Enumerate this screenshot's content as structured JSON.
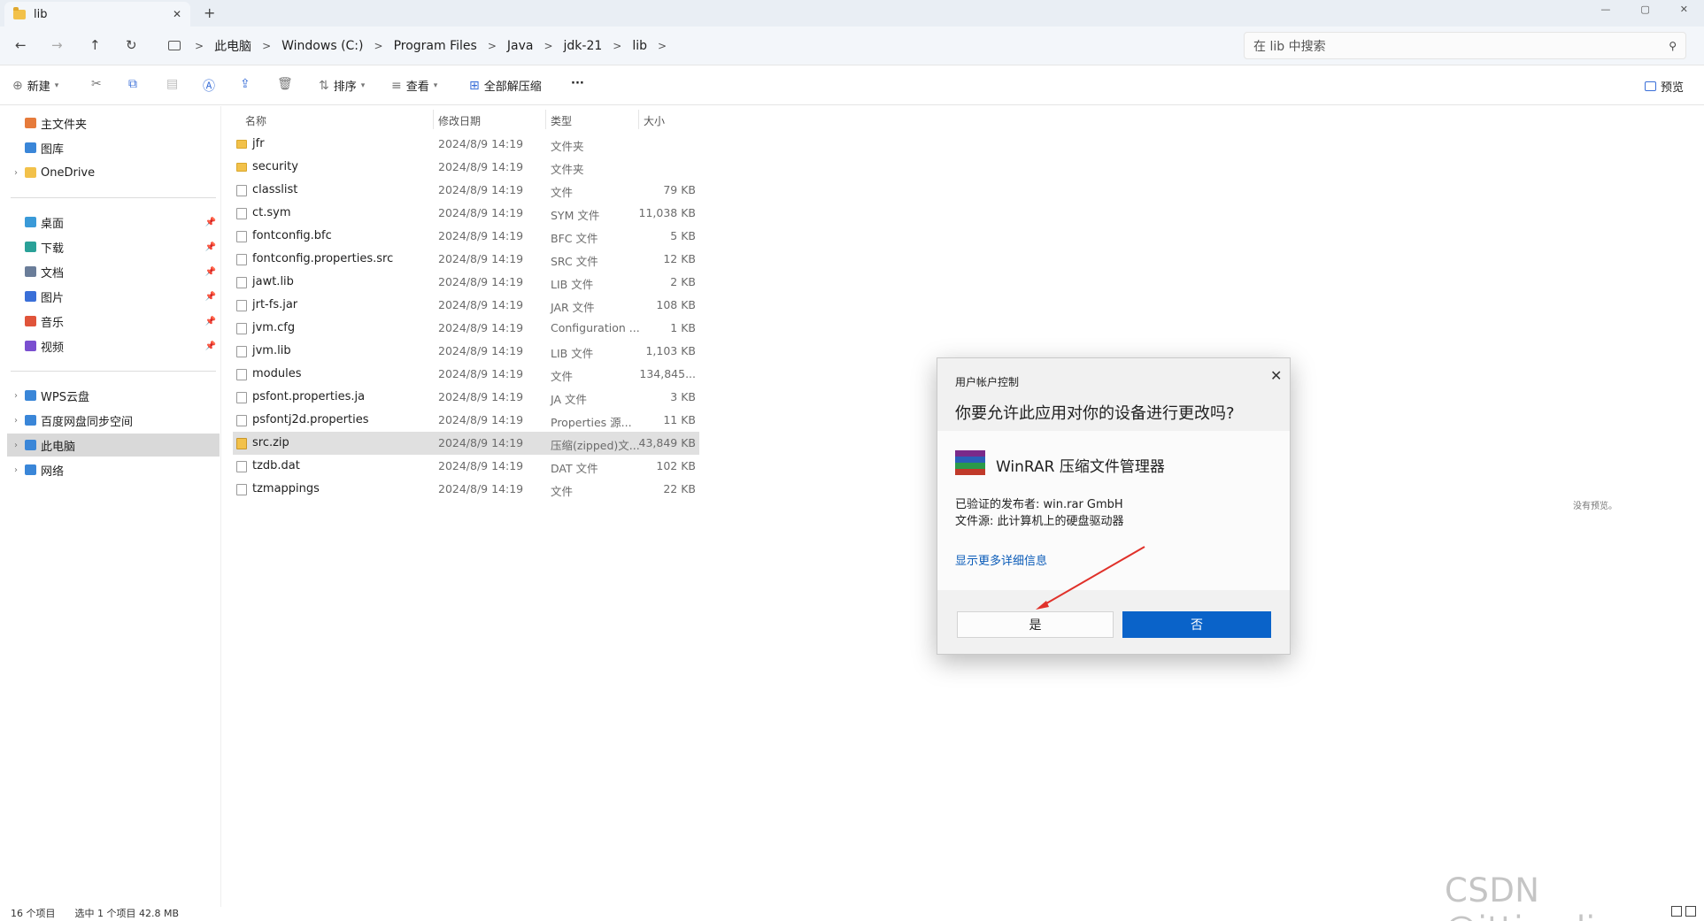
{
  "window": {
    "tab_title": "lib",
    "tab_close": "✕",
    "new_tab": "+",
    "min": "—",
    "max": "▢",
    "close": "✕"
  },
  "nav": {
    "back": "←",
    "forward": "→",
    "up": "↑",
    "refresh": "↻",
    "breadcrumb": [
      "此电脑",
      "Windows (C:)",
      "Program Files",
      "Java",
      "jdk-21",
      "lib"
    ],
    "search_placeholder": "在 lib 中搜索"
  },
  "toolbar": {
    "new": "新建",
    "sort": "排序",
    "view": "查看",
    "extract_all": "全部解压缩",
    "more": "···",
    "preview": "预览"
  },
  "sidebar": {
    "top": [
      {
        "label": "主文件夹",
        "icon": "home-icon",
        "color": "#e67b3b"
      },
      {
        "label": "图库",
        "icon": "gallery-icon",
        "color": "#3a86d8"
      },
      {
        "label": "OneDrive",
        "icon": "folder-icon",
        "color": "#f2c14a"
      }
    ],
    "quick": [
      {
        "label": "桌面",
        "icon": "desktop-icon",
        "color": "#3a9ad8"
      },
      {
        "label": "下载",
        "icon": "download-icon",
        "color": "#2aa198"
      },
      {
        "label": "文档",
        "icon": "documents-icon",
        "color": "#6a7d99"
      },
      {
        "label": "图片",
        "icon": "pictures-icon",
        "color": "#3a6fd8"
      },
      {
        "label": "音乐",
        "icon": "music-icon",
        "color": "#e0543a"
      },
      {
        "label": "视频",
        "icon": "videos-icon",
        "color": "#7a4fd0"
      }
    ],
    "bottom": [
      {
        "label": "WPS云盘",
        "icon": "cloud-icon",
        "color": "#3a86d8"
      },
      {
        "label": "百度网盘同步空间",
        "icon": "baidu-netdisk-icon",
        "color": "#3a86d8"
      },
      {
        "label": "此电脑",
        "icon": "this-pc-icon",
        "color": "#3a86d8"
      },
      {
        "label": "网络",
        "icon": "network-icon",
        "color": "#3a86d8"
      }
    ]
  },
  "columns": {
    "name": "名称",
    "date": "修改日期",
    "type": "类型",
    "size": "大小"
  },
  "files": [
    {
      "name": "jfr",
      "date": "2024/8/9 14:19",
      "type": "文件夹",
      "size": "",
      "kind": "folder"
    },
    {
      "name": "security",
      "date": "2024/8/9 14:19",
      "type": "文件夹",
      "size": "",
      "kind": "folder"
    },
    {
      "name": "classlist",
      "date": "2024/8/9 14:19",
      "type": "文件",
      "size": "79 KB",
      "kind": "file"
    },
    {
      "name": "ct.sym",
      "date": "2024/8/9 14:19",
      "type": "SYM 文件",
      "size": "11,038 KB",
      "kind": "file"
    },
    {
      "name": "fontconfig.bfc",
      "date": "2024/8/9 14:19",
      "type": "BFC 文件",
      "size": "5 KB",
      "kind": "file"
    },
    {
      "name": "fontconfig.properties.src",
      "date": "2024/8/9 14:19",
      "type": "SRC 文件",
      "size": "12 KB",
      "kind": "file"
    },
    {
      "name": "jawt.lib",
      "date": "2024/8/9 14:19",
      "type": "LIB 文件",
      "size": "2 KB",
      "kind": "file"
    },
    {
      "name": "jrt-fs.jar",
      "date": "2024/8/9 14:19",
      "type": "JAR 文件",
      "size": "108 KB",
      "kind": "file"
    },
    {
      "name": "jvm.cfg",
      "date": "2024/8/9 14:19",
      "type": "Configuration ...",
      "size": "1 KB",
      "kind": "file"
    },
    {
      "name": "jvm.lib",
      "date": "2024/8/9 14:19",
      "type": "LIB 文件",
      "size": "1,103 KB",
      "kind": "file"
    },
    {
      "name": "modules",
      "date": "2024/8/9 14:19",
      "type": "文件",
      "size": "134,845...",
      "kind": "file"
    },
    {
      "name": "psfont.properties.ja",
      "date": "2024/8/9 14:19",
      "type": "JA 文件",
      "size": "3 KB",
      "kind": "file"
    },
    {
      "name": "psfontj2d.properties",
      "date": "2024/8/9 14:19",
      "type": "Properties 源...",
      "size": "11 KB",
      "kind": "file"
    },
    {
      "name": "src.zip",
      "date": "2024/8/9 14:19",
      "type": "压缩(zipped)文...",
      "size": "43,849 KB",
      "kind": "zip",
      "selected": true
    },
    {
      "name": "tzdb.dat",
      "date": "2024/8/9 14:19",
      "type": "DAT 文件",
      "size": "102 KB",
      "kind": "file"
    },
    {
      "name": "tzmappings",
      "date": "2024/8/9 14:19",
      "type": "文件",
      "size": "22 KB",
      "kind": "file"
    }
  ],
  "preview_pane": {
    "text": "没有预览。"
  },
  "status": {
    "count": "16 个项目",
    "selected": "选中 1 个项目 42.8 MB"
  },
  "uac": {
    "caption": "用户帐户控制",
    "question": "你要允许此应用对你的设备进行更改吗?",
    "app_name": "WinRAR 压缩文件管理器",
    "publisher": "已验证的发布者: win.rar GmbH",
    "source": "文件源: 此计算机上的硬盘驱动器",
    "details_link": "显示更多详细信息",
    "yes": "是",
    "no": "否",
    "close": "✕"
  },
  "watermark": "CSDN @ittimeline",
  "colors": {
    "accent": "#0a63c9",
    "arrow": "#e0312a",
    "selection": "#e0e0e0"
  }
}
